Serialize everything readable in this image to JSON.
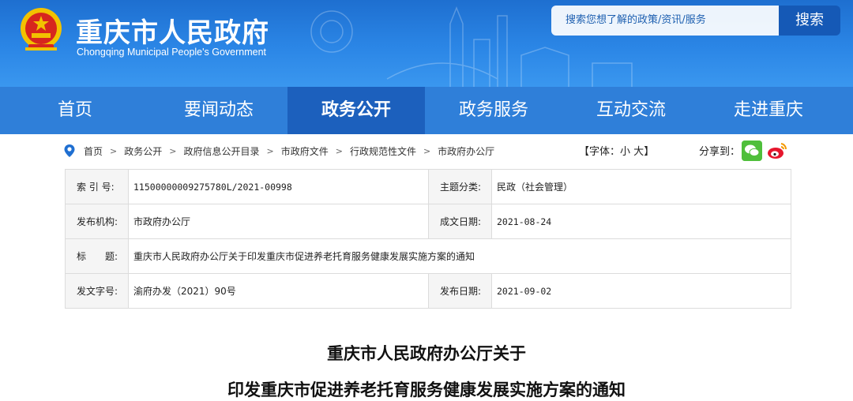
{
  "header": {
    "site_title": "重庆市人民政府",
    "site_subtitle": "Chongqing Municipal People's Government",
    "search_placeholder": "搜索您想了解的政策/资讯/服务",
    "search_button": "搜索",
    "emblem": "national-emblem-icon"
  },
  "nav": {
    "items": [
      {
        "label": "首页"
      },
      {
        "label": "要闻动态"
      },
      {
        "label": "政务公开"
      },
      {
        "label": "政务服务"
      },
      {
        "label": "互动交流"
      },
      {
        "label": "走进重庆"
      }
    ],
    "active_index": 2
  },
  "breadcrumb": {
    "items": [
      "首页",
      "政务公开",
      "政府信息公开目录",
      "市政府文件",
      "行政规范性文件",
      "市政府办公厅"
    ],
    "separator": ">"
  },
  "font_control": {
    "prefix": "【字体：",
    "small": "小",
    "large": "大",
    "suffix": "】"
  },
  "share": {
    "label": "分享到：",
    "icons": [
      "wechat-icon",
      "weibo-icon"
    ]
  },
  "info_table": {
    "index_label": "索 引 号:",
    "index_value": "11500000009275780L/2021-00998",
    "category_label": "主题分类:",
    "category_value": "民政（社会管理）",
    "issuer_label": "发布机构:",
    "issuer_value": "市政府办公厅",
    "created_label": "成文日期:",
    "created_value": "2021-08-24",
    "title_label": "标　　题:",
    "title_value": "重庆市人民政府办公厅关于印发重庆市促进养老托育服务健康发展实施方案的通知",
    "docno_label": "发文字号:",
    "docno_value": "渝府办发（2021）90号",
    "published_label": "发布日期:",
    "published_value": "2021-09-02"
  },
  "document": {
    "title_line1": "重庆市人民政府办公厅关于",
    "title_line2": "印发重庆市促进养老托育服务健康发展实施方案的通知"
  },
  "colors": {
    "header_blue": "#2b86e6",
    "nav_blue": "#2f7fd9",
    "nav_active": "#1c60bd",
    "search_button": "#1559b6"
  }
}
